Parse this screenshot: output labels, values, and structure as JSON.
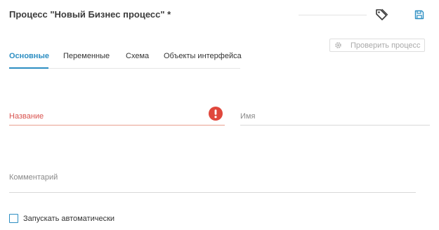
{
  "header": {
    "title": "Процесс \"Новый Бизнес процесс\" *",
    "tag_icon": "tag-icon",
    "save_icon": "save-icon"
  },
  "toolbar": {
    "check_process_label": "Проверить процесс",
    "check_process_icon": "gear-icon"
  },
  "tabs": [
    {
      "label": "Основные",
      "active": true
    },
    {
      "label": "Переменные",
      "active": false
    },
    {
      "label": "Схема",
      "active": false
    },
    {
      "label": "Объекты интерфейса",
      "active": false
    }
  ],
  "form": {
    "name_label": "Название",
    "name_value": "",
    "name_error_icon": "exclamation-icon",
    "id_label": "Имя",
    "id_value": "",
    "comment_label": "Комментарий",
    "comment_value": "",
    "autostart_label": "Запускать автоматически",
    "autostart_checked": false
  },
  "colors": {
    "accent": "#2c8ec2",
    "error": "#d9534f"
  }
}
